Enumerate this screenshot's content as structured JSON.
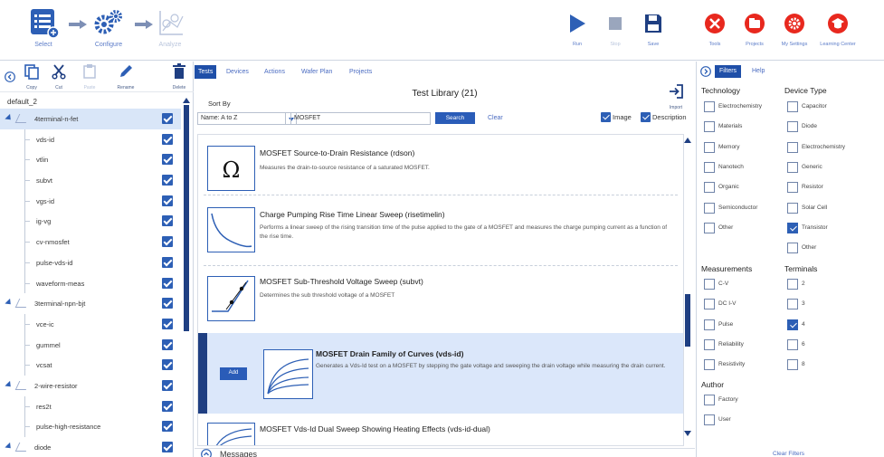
{
  "toolbar": {
    "workflow": [
      {
        "label": "Select",
        "icon": "select-list-icon",
        "enabled": true
      },
      {
        "label": "Configure",
        "icon": "gears-icon",
        "enabled": true
      },
      {
        "label": "Analyze",
        "icon": "analyze-chart-icon",
        "enabled": false
      }
    ],
    "actions": [
      {
        "label": "Run",
        "icon": "play-icon",
        "enabled": true
      },
      {
        "label": "Stop",
        "icon": "stop-icon",
        "enabled": false
      },
      {
        "label": "Save",
        "icon": "save-icon",
        "enabled": true
      },
      {
        "label": "Tools",
        "icon": "tools-icon",
        "enabled": true
      },
      {
        "label": "Projects",
        "icon": "projects-icon",
        "enabled": true
      },
      {
        "label": "My Settings",
        "icon": "settings-icon",
        "enabled": true
      },
      {
        "label": "Learning Center",
        "icon": "learning-center-icon",
        "enabled": true
      }
    ]
  },
  "project_tree": {
    "tools": [
      {
        "label": "Copy",
        "icon": "copy-icon",
        "enabled": true
      },
      {
        "label": "Cut",
        "icon": "cut-icon",
        "enabled": true
      },
      {
        "label": "Paste",
        "icon": "paste-icon",
        "enabled": false
      },
      {
        "label": "Rename",
        "icon": "rename-icon",
        "enabled": true
      },
      {
        "label": "Delete",
        "icon": "delete-icon",
        "enabled": true
      }
    ],
    "project_name": "default_2",
    "items": [
      {
        "label": "4terminal-n-fet",
        "level": 0,
        "expandable": true,
        "selected": true
      },
      {
        "label": "vds-id",
        "level": 1
      },
      {
        "label": "vtlin",
        "level": 1
      },
      {
        "label": "subvt",
        "level": 1
      },
      {
        "label": "vgs-id",
        "level": 1
      },
      {
        "label": "ig-vg",
        "level": 1
      },
      {
        "label": "cv-nmosfet",
        "level": 1
      },
      {
        "label": "pulse-vds-id",
        "level": 1
      },
      {
        "label": "waveform-meas",
        "level": 1
      },
      {
        "label": "3terminal-npn-bjt",
        "level": 0,
        "expandable": true
      },
      {
        "label": "vce-ic",
        "level": 1
      },
      {
        "label": "gummel",
        "level": 1
      },
      {
        "label": "vcsat",
        "level": 1
      },
      {
        "label": "2-wire-resistor",
        "level": 0,
        "expandable": true
      },
      {
        "label": "res2t",
        "level": 1
      },
      {
        "label": "pulse-high-resistance",
        "level": 1
      },
      {
        "label": "diode",
        "level": 0,
        "expandable": true
      }
    ]
  },
  "center": {
    "tabs": [
      "Tests",
      "Devices",
      "Actions",
      "Wafer Plan",
      "Projects"
    ],
    "active_tab": "Tests",
    "library_title": "Test Library (21)",
    "sort_by_label": "Sort By",
    "sort_value": "Name: A to Z",
    "search_value": "MOSFET",
    "search_button": "Search",
    "clear_link": "Clear",
    "image_label": "Image",
    "description_label": "Description",
    "import_label": "Import",
    "tests": [
      {
        "title": "MOSFET Source-to-Drain Resistance (rdson)",
        "description": "Measures the drain-to-source resistance of a saturated MOSFET.",
        "thumb": "omega-icon"
      },
      {
        "title": "Charge Pumping Rise Time Linear Sweep (risetimelin)",
        "description": "Performs a linear sweep of the rising transition time of the pulse applied to the gate of a MOSFET and measures the charge pumping current as a function of the rise time.",
        "thumb": "decay-curve-thumb"
      },
      {
        "title": "MOSFET Sub-Threshold Voltage Sweep (subvt)",
        "description": "Determines the sub threshold voltage of a MOSFET",
        "thumb": "threshold-thumb"
      },
      {
        "title": "MOSFET Drain Family of Curves (vds-id)",
        "description": "Generates a Vds-Id test on a MOSFET by stepping the gate voltage and sweeping the drain voltage while measuring the drain current.",
        "thumb": "family-curves-thumb",
        "selected": true
      },
      {
        "title": "MOSFET Vds-Id Dual Sweep Showing Heating Effects (vds-id-dual)",
        "description": "",
        "thumb": "family-curves-thumb"
      }
    ],
    "add_button": "Add",
    "messages_label": "Messages"
  },
  "filters": {
    "tabs": [
      "Filters",
      "Help"
    ],
    "active_tab": "Filters",
    "technology": {
      "heading": "Technology",
      "options": [
        {
          "label": "Electrochemistry",
          "checked": false
        },
        {
          "label": "Materials",
          "checked": false
        },
        {
          "label": "Memory",
          "checked": false
        },
        {
          "label": "Nanotech",
          "checked": false
        },
        {
          "label": "Organic",
          "checked": false
        },
        {
          "label": "Semiconductor",
          "checked": false
        },
        {
          "label": "Other",
          "checked": false
        }
      ]
    },
    "device_type": {
      "heading": "Device Type",
      "options": [
        {
          "label": "Capacitor",
          "checked": false
        },
        {
          "label": "Diode",
          "checked": false
        },
        {
          "label": "Electrochemistry",
          "checked": false
        },
        {
          "label": "Generic",
          "checked": false
        },
        {
          "label": "Resistor",
          "checked": false
        },
        {
          "label": "Solar Cell",
          "checked": false
        },
        {
          "label": "Transistor",
          "checked": true
        },
        {
          "label": "Other",
          "checked": false
        }
      ]
    },
    "measurements": {
      "heading": "Measurements",
      "options": [
        {
          "label": "C-V",
          "checked": false
        },
        {
          "label": "DC I-V",
          "checked": false
        },
        {
          "label": "Pulse",
          "checked": false
        },
        {
          "label": "Reliability",
          "checked": false
        },
        {
          "label": "Resistivity",
          "checked": false
        }
      ]
    },
    "terminals": {
      "heading": "Terminals",
      "options": [
        {
          "label": "2",
          "checked": false
        },
        {
          "label": "3",
          "checked": false
        },
        {
          "label": "4",
          "checked": true
        },
        {
          "label": "6",
          "checked": false
        },
        {
          "label": "8",
          "checked": false
        }
      ]
    },
    "author": {
      "heading": "Author",
      "options": [
        {
          "label": "Factory",
          "checked": false
        },
        {
          "label": "User",
          "checked": false
        }
      ]
    },
    "clear_filters": "Clear Filters"
  },
  "colors": {
    "accent": "#2D5FB5",
    "dark_accent": "#1F3F82",
    "link": "#4A6BC1",
    "danger": "#E8281E",
    "selected_bg": "#DBE7FA"
  }
}
